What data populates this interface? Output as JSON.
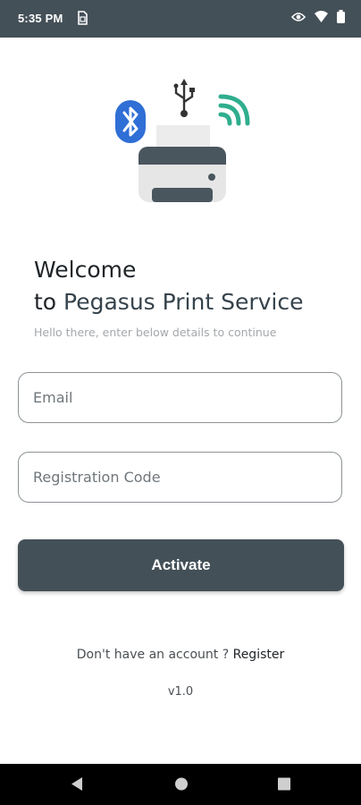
{
  "status_bar": {
    "time": "5:35 PM",
    "icons": [
      "sim-icon",
      "eye-icon",
      "wifi-icon",
      "battery-icon"
    ]
  },
  "hero": {
    "icons": [
      "printer-icon",
      "bluetooth-icon",
      "usb-icon",
      "wifi-waves-icon"
    ],
    "colors": {
      "bluetooth": "#2f6fd6",
      "wifi": "#2fae8d",
      "printer_dark": "#445058"
    }
  },
  "welcome": {
    "line1": "Welcome",
    "line2_prefix": "to ",
    "line2_brand": "Pegasus Print Service",
    "subtitle": "Hello there, enter below details to continue"
  },
  "form": {
    "email_placeholder": "Email",
    "email_value": "",
    "code_placeholder": "Registration Code",
    "code_value": "",
    "activate_label": "Activate"
  },
  "footer": {
    "prompt": "Don't have an account ? ",
    "register_label": "Register",
    "version": "v1.0"
  },
  "nav_bar": {
    "buttons": [
      "back-icon",
      "home-icon",
      "recents-icon"
    ]
  },
  "theme": {
    "primary": "#445058",
    "background": "#ffffff"
  }
}
